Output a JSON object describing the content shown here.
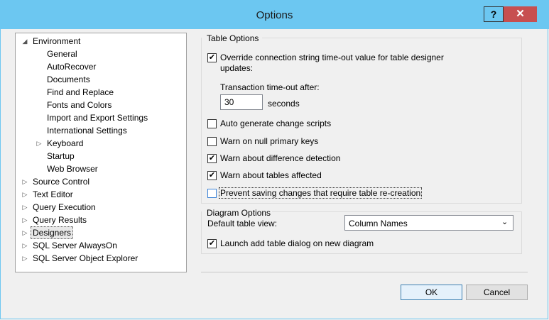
{
  "window": {
    "title": "Options",
    "help_glyph": "?",
    "close_glyph": "✕"
  },
  "tree": {
    "items": [
      {
        "label": "Environment",
        "expander": "◢"
      },
      {
        "label": "General"
      },
      {
        "label": "AutoRecover"
      },
      {
        "label": "Documents"
      },
      {
        "label": "Find and Replace"
      },
      {
        "label": "Fonts and Colors"
      },
      {
        "label": "Import and Export Settings"
      },
      {
        "label": "International Settings"
      },
      {
        "label": "Keyboard",
        "expander": "▷"
      },
      {
        "label": "Startup"
      },
      {
        "label": "Web Browser"
      },
      {
        "label": "Source Control",
        "expander": "▷"
      },
      {
        "label": "Text Editor",
        "expander": "▷"
      },
      {
        "label": "Query Execution",
        "expander": "▷"
      },
      {
        "label": "Query Results",
        "expander": "▷"
      },
      {
        "label": "Designers",
        "expander": "▷",
        "selected": true
      },
      {
        "label": "SQL Server AlwaysOn",
        "expander": "▷"
      },
      {
        "label": "SQL Server Object Explorer",
        "expander": "▷"
      }
    ]
  },
  "table_options": {
    "title": "Table Options",
    "override": {
      "checked": true,
      "line1": "Override connection string time-out value for table designer",
      "line2": "updates:"
    },
    "timeout_label": "Transaction time-out after:",
    "timeout_value": "30",
    "timeout_unit": "seconds",
    "auto_generate": {
      "checked": false,
      "label": "Auto generate change scripts"
    },
    "warn_null": {
      "checked": false,
      "label": "Warn on null primary keys"
    },
    "warn_difference": {
      "checked": true,
      "label": "Warn about difference detection"
    },
    "warn_tables": {
      "checked": true,
      "label": "Warn about tables affected"
    },
    "prevent_saving": {
      "checked": false,
      "label": "Prevent saving changes that require table re-creation"
    }
  },
  "diagram_options": {
    "title": "Diagram Options",
    "default_view_label": "Default table view:",
    "default_view_value": "Column Names",
    "launch_add": {
      "checked": true,
      "label": "Launch add table dialog on new diagram"
    }
  },
  "buttons": {
    "ok": "OK",
    "cancel": "Cancel"
  },
  "colors": {
    "title_bar": "#6cc7f1",
    "close_button": "#c74f50",
    "checkbox_focus": "#3b82d6"
  }
}
